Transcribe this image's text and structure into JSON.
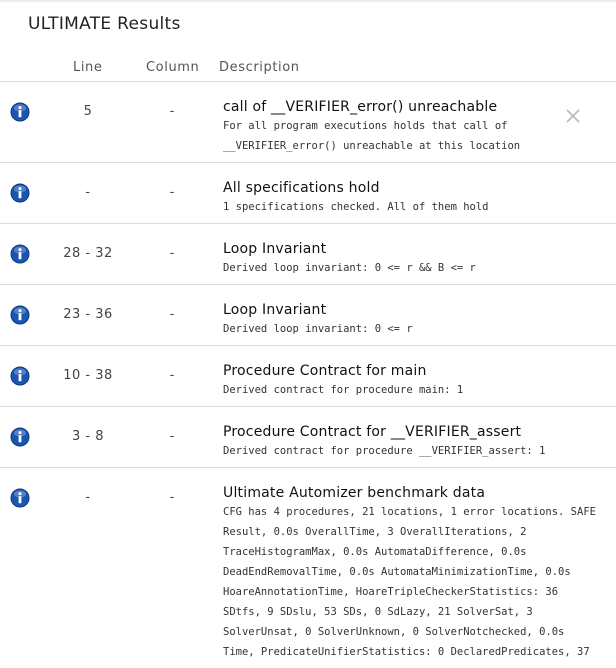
{
  "panel": {
    "title": "ULTIMATE Results"
  },
  "columns": {
    "line": "Line",
    "column": "Column",
    "description": "Description"
  },
  "results": [
    {
      "line": "5",
      "column": "-",
      "title": "call of __VERIFIER_error() unreachable",
      "body": [
        "For all program executions holds that call of",
        "__VERIFIER_error() unreachable at this location"
      ],
      "closable": true
    },
    {
      "line": "-",
      "column": "-",
      "title": "All specifications hold",
      "body": [
        "1 specifications checked. All of them hold"
      ]
    },
    {
      "line": "28 - 32",
      "column": "-",
      "title": "Loop Invariant",
      "body": [
        "Derived loop invariant: 0 <= r && B <= r"
      ]
    },
    {
      "line": "23 - 36",
      "column": "-",
      "title": "Loop Invariant",
      "body": [
        "Derived loop invariant: 0 <= r"
      ]
    },
    {
      "line": "10 - 38",
      "column": "-",
      "title": "Procedure Contract for main",
      "body": [
        "Derived contract for procedure main: 1"
      ]
    },
    {
      "line": "3 - 8",
      "column": "-",
      "title": "Procedure Contract for __VERIFIER_assert",
      "body": [
        "Derived contract for procedure __VERIFIER_assert: 1"
      ]
    },
    {
      "line": "-",
      "column": "-",
      "title": "Ultimate Automizer benchmark data",
      "body": [
        "CFG has 4 procedures, 21 locations, 1 error locations. SAFE",
        "Result, 0.0s OverallTime, 3 OverallIterations, 2",
        "TraceHistogramMax, 0.0s AutomataDifference, 0.0s",
        "DeadEndRemovalTime, 0.0s AutomataMinimizationTime, 0.0s",
        "HoareAnnotationTime, HoareTripleCheckerStatistics: 36",
        "SDtfs, 9 SDslu, 53 SDs, 0 SdLazy, 21 SolverSat, 3",
        "SolverUnsat, 0 SolverUnknown, 0 SolverNotchecked, 0.0s",
        "Time, PredicateUnifierStatistics: 0 DeclaredPredicates, 37"
      ]
    }
  ],
  "icons": {
    "info": "info-circle-icon",
    "close": "close-x-icon"
  },
  "colors": {
    "info_blue": "#1a56b0",
    "divider": "#dcdcdc"
  }
}
